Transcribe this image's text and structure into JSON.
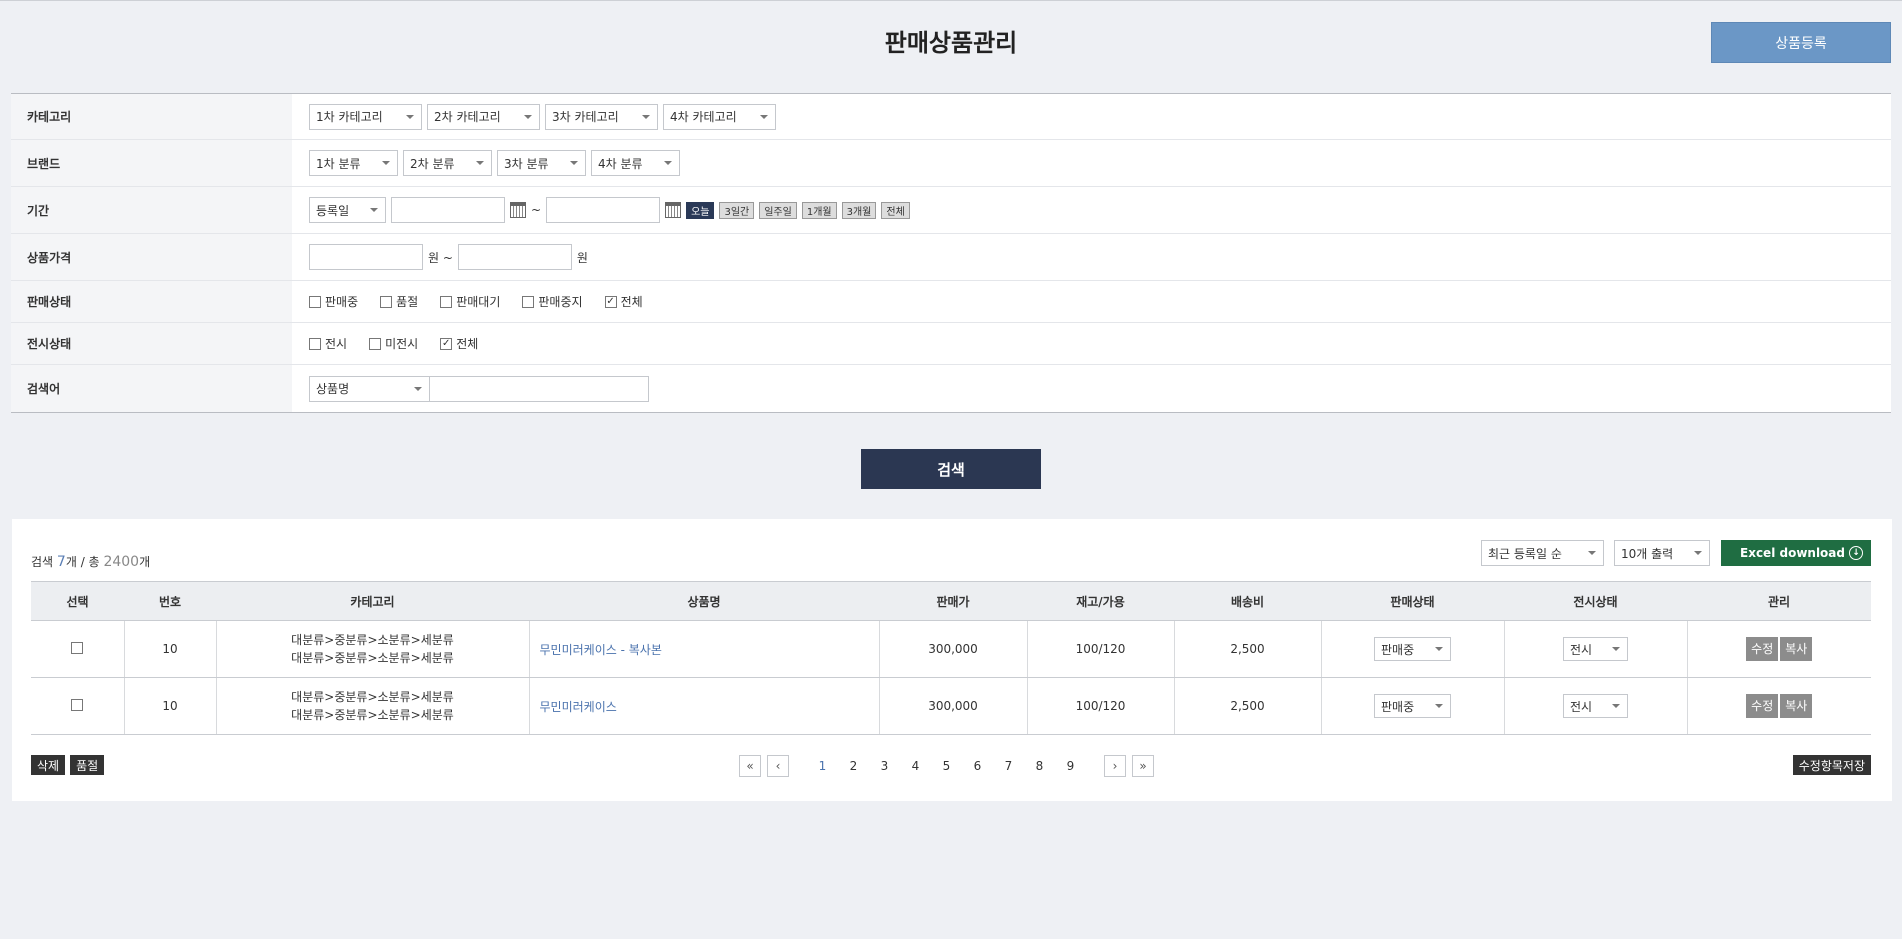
{
  "header": {
    "title": "판매상품관리",
    "register_label": "상품등록"
  },
  "filter": {
    "category_label": "카테고리",
    "category_selects": [
      "1차 카테고리",
      "2차 카테고리",
      "3차 카테고리",
      "4차 카테고리"
    ],
    "brand_label": "브랜드",
    "brand_selects": [
      "1차 분류",
      "2차 분류",
      "3차 분류",
      "4차 분류"
    ],
    "period_label": "기간",
    "period_type": "등록일",
    "period_sep": "~",
    "quick_buttons": [
      "오늘",
      "3일간",
      "일주일",
      "1개월",
      "3개월",
      "전체"
    ],
    "price_label": "상품가격",
    "price_unit": "원",
    "price_sep": "원 ~",
    "sale_status_label": "판매상태",
    "sale_status_options": [
      {
        "label": "판매중",
        "checked": false
      },
      {
        "label": "품절",
        "checked": false
      },
      {
        "label": "판매대기",
        "checked": false
      },
      {
        "label": "판매중지",
        "checked": false
      },
      {
        "label": "전체",
        "checked": true
      }
    ],
    "display_status_label": "전시상태",
    "display_status_options": [
      {
        "label": "전시",
        "checked": false
      },
      {
        "label": "미전시",
        "checked": false
      },
      {
        "label": "전체",
        "checked": true
      }
    ],
    "keyword_label": "검색어",
    "keyword_type": "상품명",
    "keyword_value": ""
  },
  "search_label": "검색",
  "results": {
    "summary_prefix": "검색",
    "count": "7",
    "summary_mid": "개 / 총",
    "total": "2400",
    "summary_suffix": "개",
    "sort_value": "최근 등록일 순",
    "page_size_value": "10개 출력",
    "excel_label": "Excel download",
    "columns": [
      "선택",
      "번호",
      "카테고리",
      "상품명",
      "판매가",
      "재고/가용",
      "배송비",
      "판매상태",
      "전시상태",
      "관리"
    ],
    "rows": [
      {
        "no": "10",
        "cat1": "대분류>중분류>소분류>세분류",
        "cat2": "대분류>중분류>소분류>세분류",
        "name": "무민미러케이스 - 복사본",
        "price": "300,000",
        "stock": "100/120",
        "shipping": "2,500",
        "sale_status": "판매중",
        "display_status": "전시",
        "edit": "수정",
        "copy": "복사"
      },
      {
        "no": "10",
        "cat1": "대분류>중분류>소분류>세분류",
        "cat2": "대분류>중분류>소분류>세분류",
        "name": "무민미러케이스",
        "price": "300,000",
        "stock": "100/120",
        "shipping": "2,500",
        "sale_status": "판매중",
        "display_status": "전시",
        "edit": "수정",
        "copy": "복사"
      }
    ],
    "delete_label": "삭제",
    "soldout_label": "품절",
    "save_label": "수정항목저장",
    "pages": [
      "1",
      "2",
      "3",
      "4",
      "5",
      "6",
      "7",
      "8",
      "9"
    ],
    "current_page": "1",
    "first_symbol": "«",
    "prev_symbol": "‹",
    "next_symbol": "›",
    "last_symbol": "»"
  }
}
